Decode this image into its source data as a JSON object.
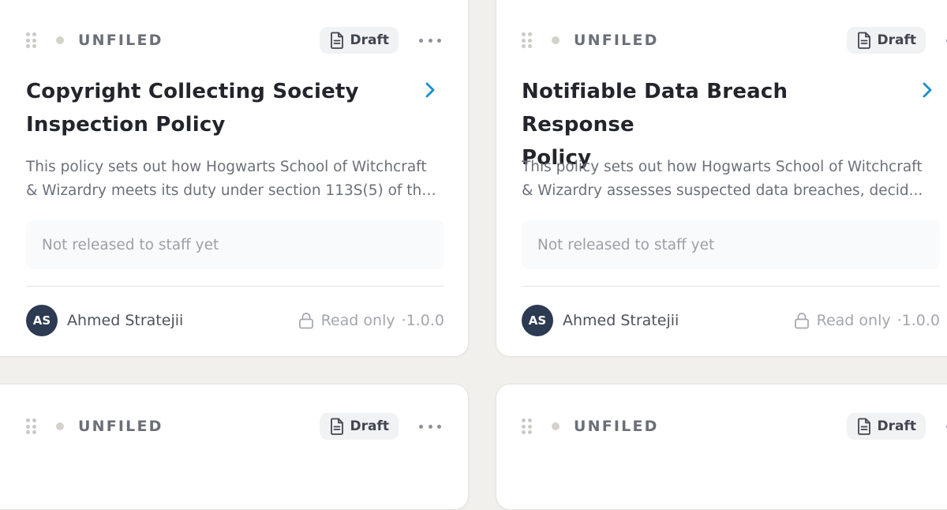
{
  "cards": [
    {
      "folder": "UNFILED",
      "status": "Draft",
      "title_lines": [
        "Copyright Collecting Society",
        "Inspection Policy"
      ],
      "description_lines": [
        "This policy sets out how Hogwarts School of Witchcraft",
        "& Wizardry meets its duty under section 113S(5) of the..."
      ],
      "release_note": "Not released to staff yet",
      "author_initials": "AS",
      "author_name": "Ahmed Stratejii",
      "access": "Read only",
      "version": "·1.0.0"
    },
    {
      "folder": "UNFILED",
      "status": "Draft",
      "title_lines": [
        "Notifiable Data Breach Response",
        "Policy"
      ],
      "description_lines": [
        "This policy sets out how Hogwarts School of Witchcraft",
        "& Wizardry assesses suspected data breaches, decid..."
      ],
      "release_note": "Not released to staff yet",
      "author_initials": "AS",
      "author_name": "Ahmed Stratejii",
      "access": "Read only",
      "version": "·1.0.0"
    },
    {
      "folder": "UNFILED",
      "status": "Draft"
    },
    {
      "folder": "UNFILED",
      "status": "Draft"
    }
  ],
  "icons": {
    "draft": "document-icon",
    "more": "more-horizontal-icon",
    "drag": "drag-handle-icon",
    "open": "chevron-right-icon",
    "lock": "lock-icon"
  },
  "colors": {
    "background": "#f1f0ec",
    "card": "#ffffff",
    "accent_link": "#1a8fd0",
    "avatar": "#2c3a52",
    "folder_text": "#6a6f78",
    "status_dot": "#d4d2ca"
  }
}
